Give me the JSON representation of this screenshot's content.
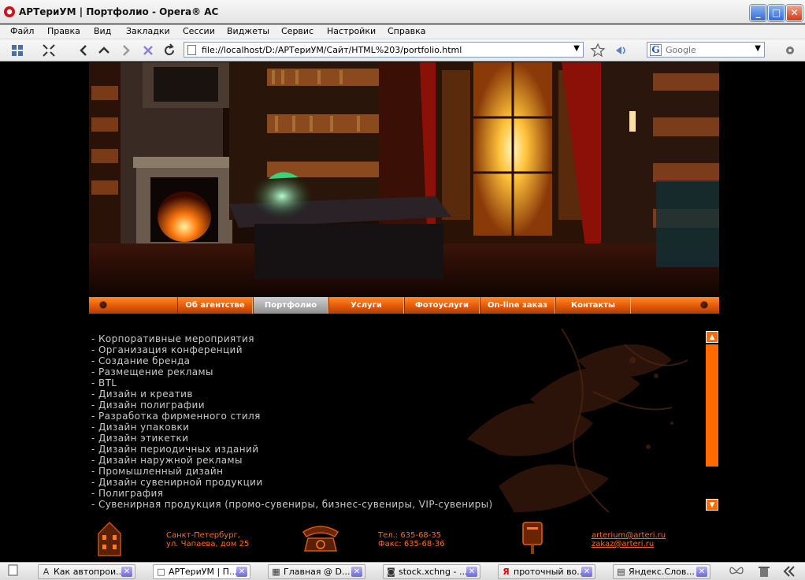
{
  "window": {
    "title": "АРТериУМ | Портфолио - Opera® AC",
    "minimize_glyph": "_",
    "maximize_glyph": "□",
    "close_glyph": "✕"
  },
  "menu": [
    "Файл",
    "Правка",
    "Вид",
    "Закладки",
    "Сессии",
    "Виджеты",
    "Сервис",
    "Настройки",
    "Справка"
  ],
  "address": {
    "url": "file://localhost/D:/АРТериУМ/Сайт/HTML%203/portfolio.html"
  },
  "search": {
    "engine_glyph": "G",
    "placeholder": "Google"
  },
  "site": {
    "nav": [
      {
        "label": "Об агентстве",
        "active": false
      },
      {
        "label": "Портфолио",
        "active": true
      },
      {
        "label": "Услуги",
        "active": false
      },
      {
        "label": "Фотоуслуги",
        "active": false
      },
      {
        "label": "On-line заказ",
        "active": false
      },
      {
        "label": "Контакты",
        "active": false
      }
    ],
    "services": [
      "- Корпоративные мероприятия",
      "- Организация конференций",
      "- Создание бренда",
      "- Размещение рекламы",
      "- BTL",
      "- Дизайн и креатив",
      "- Дизайн полиграфии",
      "- Разработка фирменного стиля",
      "- Дизайн упаковки",
      "- Дизайн этикетки",
      "- Дизайн периодичных изданий",
      "- Дизайн наружной рекламы",
      "- Промышленный дизайн",
      "- Дизайн сувенирной продукции",
      "- Полиграфия",
      "- Сувенирная продукция (промо-сувениры, бизнес-сувениры, VIP-сувениры)"
    ],
    "footer": {
      "address_line1": "Санкт-Петербург,",
      "address_line2": "ул. Чапаева, дом 25",
      "phone": "Тел.: 635-68-35",
      "fax": "Факс: 635-68-36",
      "email1": "arterium@arteri.ru",
      "email2": "zakaz@arteri.ru"
    }
  },
  "tabs": [
    {
      "label": "Как автопрои...",
      "icon": "A",
      "active": false
    },
    {
      "label": "АРТериУМ | П...",
      "icon": "□",
      "active": true
    },
    {
      "label": "Главная @ D...",
      "icon": "▦",
      "active": false
    },
    {
      "label": "stock.xchng - ...",
      "icon": "◙",
      "active": false
    },
    {
      "label": "проточный во...",
      "icon": "Я",
      "active": false
    },
    {
      "label": "Яндекс.Слов...",
      "icon": "▤",
      "active": false
    }
  ],
  "colors": {
    "accent_orange": "#ff6a00",
    "nav_active": "#a8a8a8",
    "list_text": "#c9c9c9",
    "footer_text": "#ff6a1a"
  }
}
